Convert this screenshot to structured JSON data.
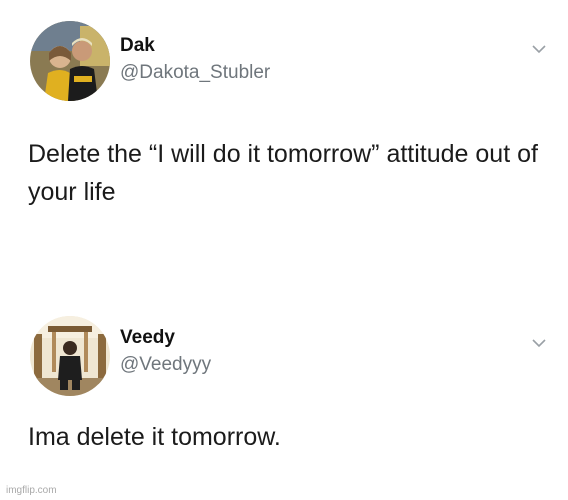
{
  "tweets": [
    {
      "name": "Dak",
      "handle": "@Dakota_Stubler",
      "text": "Delete the “I will do it tomorrow” attitude out of your life",
      "menu_icon": "chevron-down-icon"
    },
    {
      "name": "Veedy",
      "handle": "@Veedyyy",
      "text": "Ima delete it tomorrow.",
      "menu_icon": "chevron-down-icon"
    }
  ],
  "watermark": "imgflip.com",
  "colors": {
    "name": "#111111",
    "handle": "#6f767c",
    "text": "#1b1b1b",
    "chevron": "#9aa0a6",
    "watermark": "#a9a9a9"
  }
}
